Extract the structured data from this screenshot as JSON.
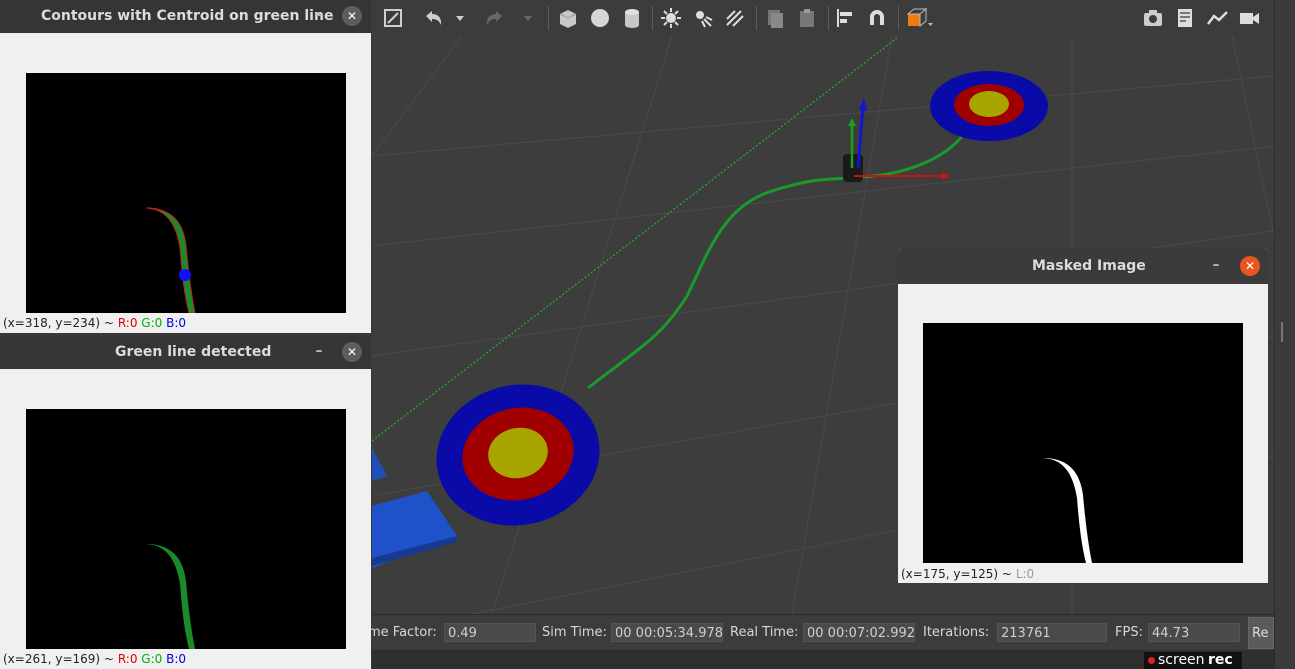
{
  "windows": {
    "contours": {
      "title": "Contours with Centroid on green line",
      "status_coords": "(x=318, y=234) ~",
      "r": "R:0",
      "g": "G:0",
      "b": "B:0"
    },
    "green_line": {
      "title": "Green line detected",
      "status_coords": "(x=261, y=169) ~",
      "r": "R:0",
      "g": "G:0",
      "b": "B:0"
    },
    "masked": {
      "title": "Masked Image",
      "status_coords": "(x=175, y=125) ~",
      "l": "L:0"
    },
    "minimize_glyph": "–",
    "close_glyph": "✕"
  },
  "toolbar": {
    "icons": [
      "fullscreen-icon",
      "undo-icon",
      "dropdown-icon",
      "redo-icon",
      "dropdown-icon",
      "box-icon",
      "sphere-icon",
      "cylinder-icon",
      "point-light-icon",
      "spot-light-icon",
      "directional-light-icon",
      "copy-icon",
      "paste-icon",
      "align-icon",
      "magnet-icon",
      "view-angle-icon",
      "screenshot-icon",
      "log-icon",
      "plot-icon",
      "video-record-icon"
    ]
  },
  "statusbar": {
    "time_factor_label": "me Factor:",
    "time_factor": "0.49",
    "sim_time_label": "Sim Time:",
    "sim_time": "00 00:05:34.978",
    "real_time_label": "Real Time:",
    "real_time": "00 00:07:02.992",
    "iterations_label": "Iterations:",
    "iterations": "213761",
    "fps_label": "FPS:",
    "fps": "44.73",
    "reset_label": "Re"
  },
  "watermark": {
    "text1": "screen",
    "text2": "rec"
  },
  "colors": {
    "target_outer": "#0a0aa8",
    "target_mid": "#a00000",
    "target_inner": "#a8a400",
    "line_green": "#1a9a2a",
    "close_active": "#e95420"
  }
}
